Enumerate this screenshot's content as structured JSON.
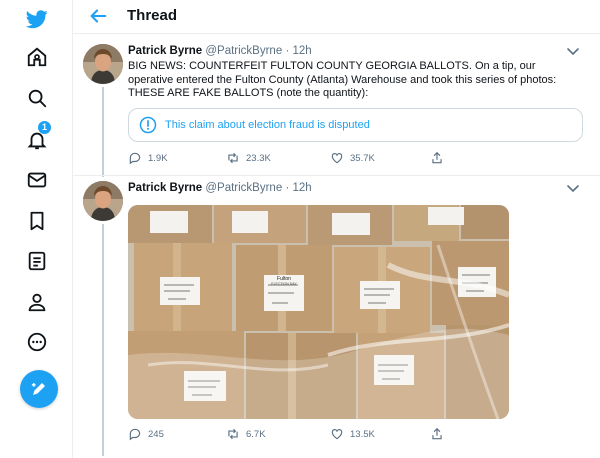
{
  "app": {
    "brand_icon": "twitter-bird-icon",
    "accent": "#1da1f2"
  },
  "nav": {
    "items": [
      {
        "name": "home",
        "icon": "home-icon"
      },
      {
        "name": "explore",
        "icon": "search-icon"
      },
      {
        "name": "notifications",
        "icon": "bell-icon",
        "badge": "1"
      },
      {
        "name": "messages",
        "icon": "mail-icon"
      },
      {
        "name": "bookmarks",
        "icon": "bookmark-icon"
      },
      {
        "name": "lists",
        "icon": "list-icon"
      },
      {
        "name": "profile",
        "icon": "person-icon"
      },
      {
        "name": "more",
        "icon": "more-circle-icon"
      }
    ],
    "compose_icon": "compose-icon"
  },
  "header": {
    "title": "Thread"
  },
  "tweets": [
    {
      "display_name": "Patrick Byrne",
      "handle": "@PatrickByrne",
      "time": "· 12h",
      "text": "BIG NEWS: COUNTERFEIT FULTON COUNTY GEORGIA BALLOTS. On a tip, our operative entered the Fulton County (Atlanta) Warehouse and took this series of photos: THESE ARE FAKE BALLOTS (note the quantity):",
      "notice": "This claim about election fraud is disputed",
      "replies": "1.9K",
      "retweets": "23.3K",
      "likes": "35.7K"
    },
    {
      "display_name": "Patrick Byrne",
      "handle": "@PatrickByrne",
      "time": "· 12h",
      "photo_label_title": "Fulton",
      "photo_label_sub": "ELECTION DAY",
      "replies": "245",
      "retweets": "6.7K",
      "likes": "13.5K"
    }
  ]
}
